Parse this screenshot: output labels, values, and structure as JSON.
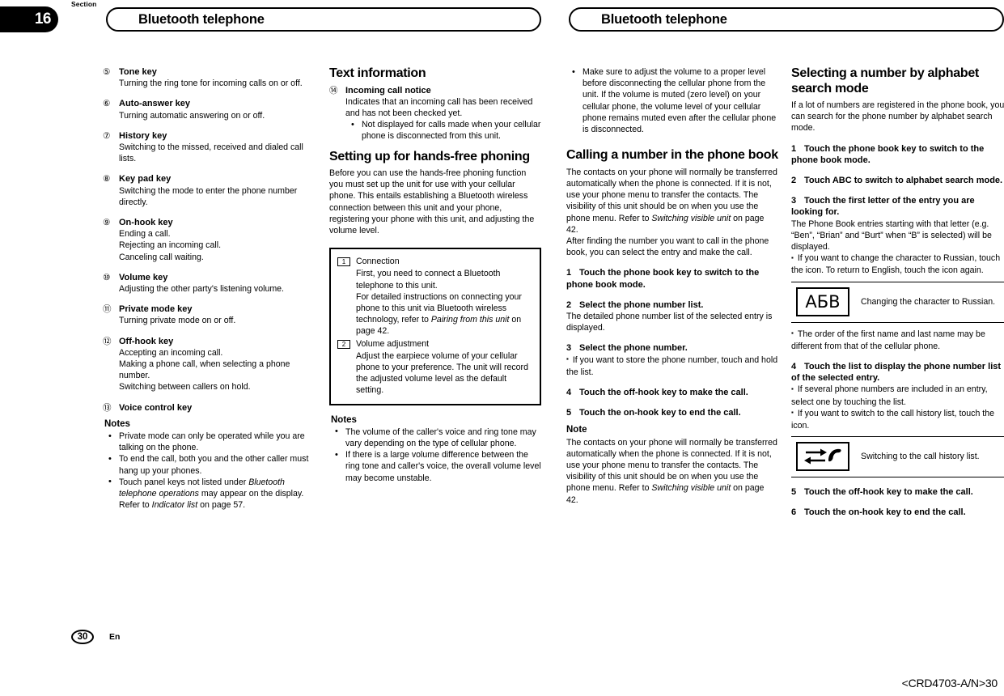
{
  "header": {
    "section_label": "Section",
    "section_number": "16",
    "title_left": "Bluetooth telephone",
    "title_right": "Bluetooth telephone"
  },
  "footer": {
    "page_number": "30",
    "language": "En",
    "doc_code": "<CRD4703-A/N>30"
  },
  "column1": {
    "keys": [
      {
        "num": "⑤",
        "title": "Tone key",
        "lines": [
          "Turning the ring tone for incoming calls on or off."
        ]
      },
      {
        "num": "⑥",
        "title": "Auto-answer key",
        "lines": [
          "Turning automatic answering on or off."
        ]
      },
      {
        "num": "⑦",
        "title": "History key",
        "lines": [
          "Switching to the missed, received and dialed call lists."
        ]
      },
      {
        "num": "⑧",
        "title": "Key pad key",
        "lines": [
          "Switching the mode to enter the phone number directly."
        ]
      },
      {
        "num": "⑨",
        "title": "On-hook key",
        "lines": [
          "Ending a call.",
          "Rejecting an incoming call.",
          "Canceling call waiting."
        ]
      },
      {
        "num": "⑩",
        "title": "Volume key",
        "lines": [
          "Adjusting the other party's listening volume."
        ]
      },
      {
        "num": "⑪",
        "title": "Private mode key",
        "lines": [
          "Turning private mode on or off."
        ]
      },
      {
        "num": "⑫",
        "title": "Off-hook key",
        "lines": [
          "Accepting an incoming call.",
          "Making a phone call, when selecting a phone number.",
          "Switching between callers on hold."
        ]
      },
      {
        "num": "⑬",
        "title": "Voice control key",
        "lines": []
      }
    ],
    "notes_head": "Notes",
    "notes": [
      "Private mode can only be operated while you are talking on the phone.",
      "To end the call, both you and the other caller must hang up your phones."
    ],
    "note3_pre": "Touch panel keys not listed under ",
    "note3_italic": "Bluetooth telephone operations",
    "note3_post": " may appear on the display.",
    "note3_refer_pre": "Refer to ",
    "note3_refer_italic": "Indicator list",
    "note3_refer_post": " on page 57."
  },
  "column2": {
    "heading1": "Text information",
    "key14_num": "⑭",
    "key14_title": "Incoming call notice",
    "key14_desc": "Indicates that an incoming call has been received and has not been checked yet.",
    "key14_bullet": "Not displayed for calls made when your cellular phone is disconnected from this unit.",
    "heading2": "Setting up for hands-free phoning",
    "intro": "Before you can use the hands-free phoning function you must set up the unit for use with your cellular phone. This entails establishing a Bluetooth wireless connection between this unit and your phone, registering your phone with this unit, and adjusting the volume level.",
    "box": [
      {
        "num": "1",
        "title": "Connection",
        "line1": "First, you need to connect a Bluetooth telephone to this unit.",
        "line2_pre": "For detailed instructions on connecting your phone to this unit via Bluetooth wireless technology, refer to ",
        "line2_italic": "Pairing from this unit",
        "line2_post": " on page 42."
      },
      {
        "num": "2",
        "title": "Volume adjustment",
        "line1": "Adjust the earpiece volume of your cellular phone to your preference. The unit will record the adjusted volume level as the default setting.",
        "line2_pre": "",
        "line2_italic": "",
        "line2_post": ""
      }
    ],
    "notes_head": "Notes",
    "notes": [
      "The volume of the caller's voice and ring tone may vary depending on the type of cellular phone.",
      "If there is a large volume difference between the ring tone and caller's voice, the overall volume level may become unstable."
    ]
  },
  "column3": {
    "top_bullet": "Make sure to adjust the volume to a proper level before disconnecting the cellular phone from the unit. If the volume is muted (zero level) on your cellular phone, the volume level of your cellular phone remains muted even after the cellular phone is disconnected.",
    "heading": "Calling a number in the phone book",
    "intro_pre": "The contacts on your phone will normally be transferred automatically when the phone is connected. If it is not, use your phone menu to transfer the contacts. The visibility of this unit should be on when you use the phone menu. Refer to ",
    "intro_italic": "Switching visible unit",
    "intro_post": " on page 42.",
    "intro_tail": "After finding the number you want to call in the phone book, you can select the entry and make the call.",
    "step1_n": "1",
    "step1": "Touch the phone book key to switch to the phone book mode.",
    "step2_n": "2",
    "step2": "Select the phone number list.",
    "step2_desc": "The detailed phone number list of the selected entry is displayed.",
    "step3_n": "3",
    "step3": "Select the phone number.",
    "step3_note": "If you want to store the phone number, touch and hold the list.",
    "step4_n": "4",
    "step4": "Touch the off-hook key to make the call.",
    "step5_n": "5",
    "step5": "Touch the on-hook key to end the call.",
    "note_head": "Note",
    "note_pre": "The contacts on your phone will normally be transferred automatically when the phone is connected. If it is not, use your phone menu to transfer the contacts. The visibility of this unit should be on when you use the phone menu. Refer to ",
    "note_italic": "Switching visible unit",
    "note_post": " on page 42."
  },
  "column4": {
    "heading": "Selecting a number by alphabet search mode",
    "intro": "If a lot of numbers are registered in the phone book, you can search for the phone number by alphabet search mode.",
    "step1_n": "1",
    "step1": "Touch the phone book key to switch to the phone book mode.",
    "step2_n": "2",
    "step2": "Touch ABC to switch to alphabet search mode.",
    "step3_n": "3",
    "step3": "Touch the first letter of the entry you are looking for.",
    "step3_desc": "The Phone Book entries starting with that letter (e.g. “Ben”, “Brian” and “Burt” when “B” is selected) will be displayed.",
    "step3_note": "If you want to change the character to Russian, touch the icon. To return to English, touch the icon again.",
    "icon1_glyph": "АБВ",
    "icon1_desc": "Changing the character to Russian.",
    "note_order": "The order of the first name and last name may be different from that of the cellular phone.",
    "step4_n": "4",
    "step4": "Touch the list to display the phone number list of the selected entry.",
    "step4_note1": "If several phone numbers are included in an entry, select one by touching the list.",
    "step4_note2": "If you want to switch to the call history list, touch the icon.",
    "icon2_desc": "Switching to the call history list.",
    "step5_n": "5",
    "step5": "Touch the off-hook key to make the call.",
    "step6_n": "6",
    "step6": "Touch the on-hook key to end the call."
  }
}
